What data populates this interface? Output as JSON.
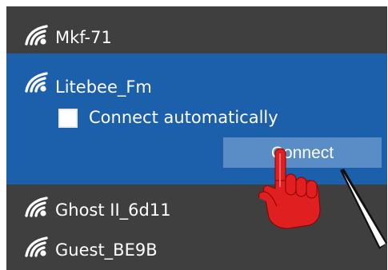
{
  "networks": [
    {
      "ssid": "Mkf-71",
      "icon": "wifi-icon"
    },
    {
      "ssid": "Litebee_Fm",
      "icon": "wifi-icon",
      "selected": true,
      "connect_automatically_label": "Connect automatically",
      "connect_automatically_checked": false,
      "connect_label": "Connect"
    },
    {
      "ssid": "Ghost II_6d11",
      "icon": "wifi-icon"
    },
    {
      "ssid": "Guest_BE9B",
      "icon": "wifi-icon"
    }
  ],
  "colors": {
    "panel_background": "#3f3f3f",
    "selected_background": "#1c5faa",
    "connect_button": "#5a8dc6",
    "pointer_hand": "#e02020"
  },
  "overlays": {
    "pointer": "hand-pointer-icon",
    "arrow": "arrow-icon"
  }
}
